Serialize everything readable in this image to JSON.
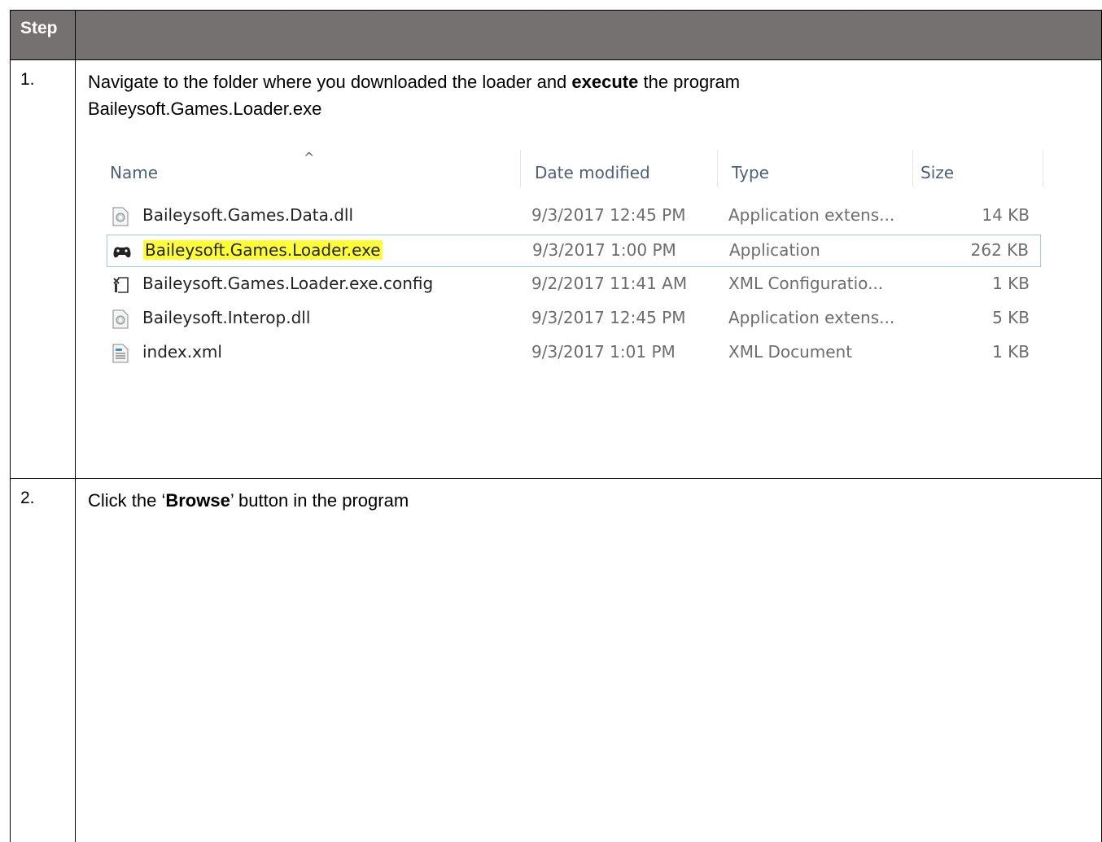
{
  "table": {
    "header_step": "Step",
    "steps": [
      {
        "number": "1.",
        "text_before": "Navigate to the folder where you downloaded the loader and ",
        "text_bold": "execute",
        "text_after": " the program",
        "line2": "Baileysoft.Games.Loader.exe"
      },
      {
        "number": "2.",
        "text_before": "Click the ‘",
        "text_bold": "Browse",
        "text_after": "’ button in the program"
      }
    ]
  },
  "explorer": {
    "columns": {
      "name": "Name",
      "date": "Date modified",
      "type": "Type",
      "size": "Size"
    },
    "sort_indicator": "^",
    "files": [
      {
        "icon": "dll-file-icon",
        "name": "Baileysoft.Games.Data.dll",
        "date": "9/3/2017 12:45 PM",
        "type": "Application extens...",
        "size": "14 KB",
        "selected": false
      },
      {
        "icon": "gamepad-icon",
        "name": "Baileysoft.Games.Loader.exe",
        "date": "9/3/2017 1:00 PM",
        "type": "Application",
        "size": "262 KB",
        "selected": true
      },
      {
        "icon": "config-file-icon",
        "name": "Baileysoft.Games.Loader.exe.config",
        "date": "9/2/2017 11:41 AM",
        "type": "XML Configuratio...",
        "size": "1 KB",
        "selected": false
      },
      {
        "icon": "dll-file-icon",
        "name": "Baileysoft.Interop.dll",
        "date": "9/3/2017 12:45 PM",
        "type": "Application extens...",
        "size": "5 KB",
        "selected": false
      },
      {
        "icon": "xml-file-icon",
        "name": "index.xml",
        "date": "9/3/2017 1:01 PM",
        "type": "XML Document",
        "size": "1 KB",
        "selected": false
      }
    ]
  },
  "colors": {
    "header_bg": "#767171",
    "highlight": "#ffff33",
    "selection_border": "#99c9ef"
  }
}
